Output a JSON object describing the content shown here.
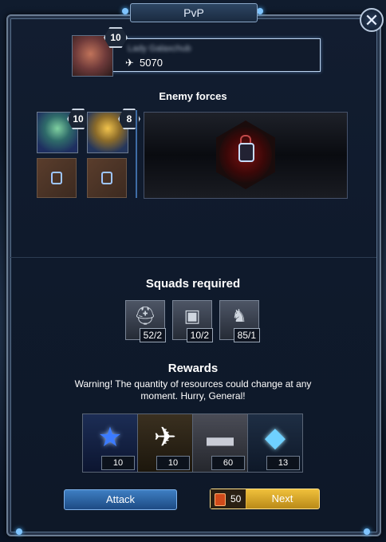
{
  "window": {
    "title": "PvP"
  },
  "player": {
    "level": "10",
    "name": "Lady Galaxchub",
    "score": "5070"
  },
  "enemy_forces": {
    "title": "Enemy forces",
    "heroes": [
      {
        "level": "10",
        "icon": "green-helmet-hero-portrait"
      },
      {
        "level": "8",
        "icon": "gold-armor-hero-portrait"
      }
    ],
    "locked_slots": 2,
    "main_slot": {
      "state": "locked",
      "icon": "red-lock-icon"
    }
  },
  "squads": {
    "title": "Squads required",
    "items": [
      {
        "icon": "infantry-helmet-icon",
        "count": "52/2"
      },
      {
        "icon": "armor-vest-icon",
        "count": "10/2"
      },
      {
        "icon": "mech-walker-icon",
        "count": "85/1"
      }
    ]
  },
  "rewards": {
    "title": "Rewards",
    "warning": "Warning! The quantity of resources could change at any moment. Hurry, General!",
    "items": [
      {
        "icon": "blue-star-icon",
        "count": "10"
      },
      {
        "icon": "eagle-icon",
        "count": "10"
      },
      {
        "icon": "metal-ingot-icon",
        "count": "60"
      },
      {
        "icon": "blue-crystal-icon",
        "count": "13"
      }
    ]
  },
  "buttons": {
    "attack": "Attack",
    "next": "Next",
    "next_cost": "50"
  },
  "colors": {
    "accent_blue": "#3e7ec2",
    "gold": "#f0c03c",
    "panel": "#121d30"
  }
}
